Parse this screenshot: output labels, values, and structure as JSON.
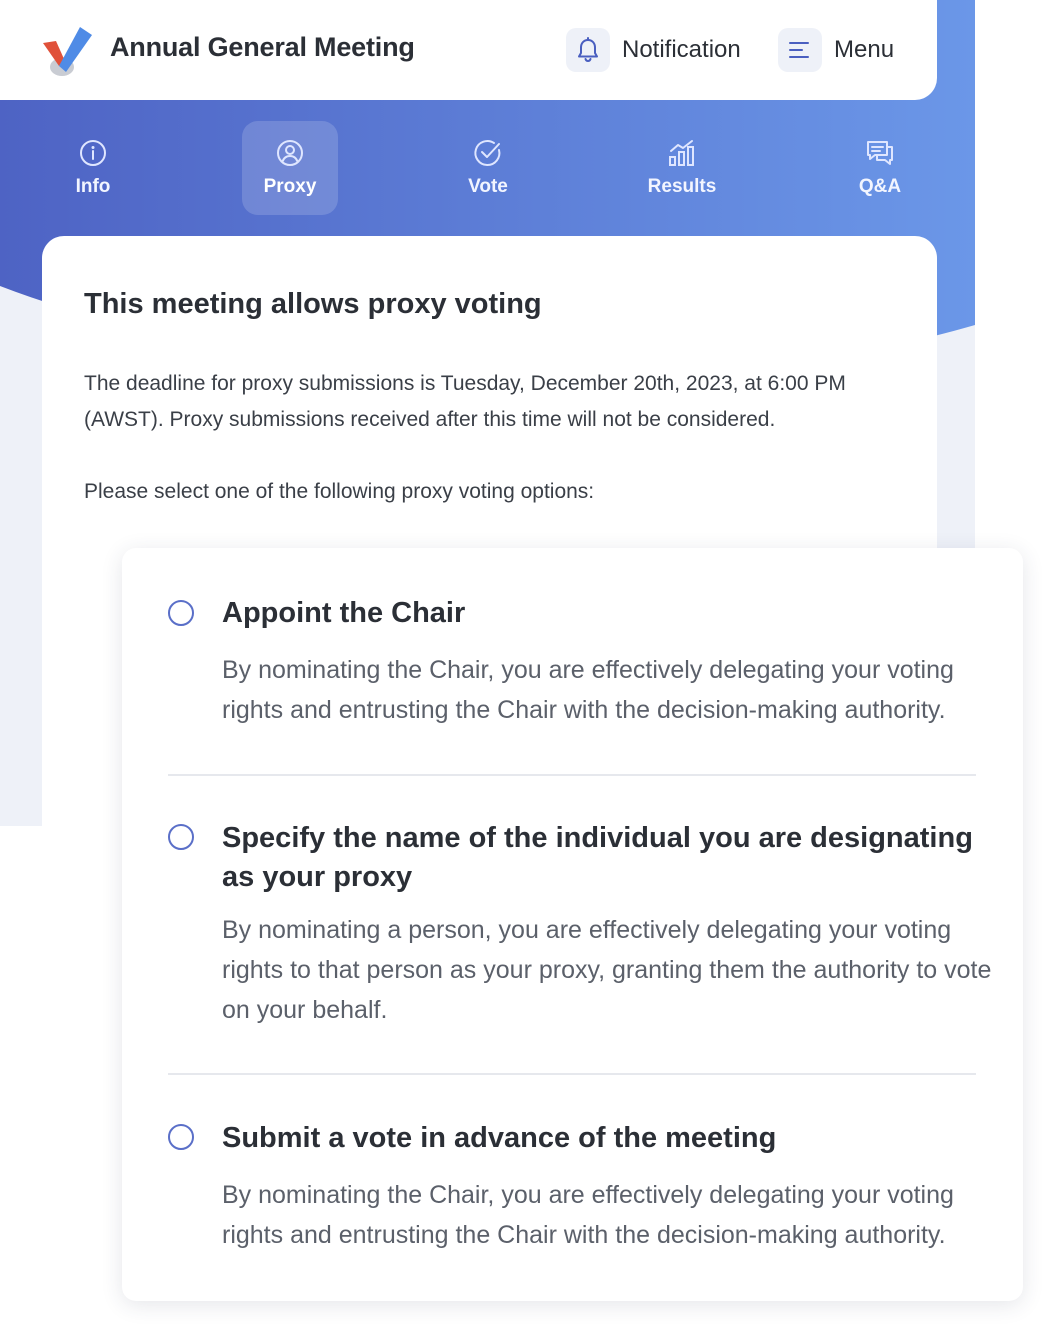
{
  "header": {
    "app_title": "Annual General Meeting",
    "notification_label": "Notification",
    "menu_label": "Menu",
    "icons": {
      "logo": "checkmark-logo",
      "notification": "bell-icon",
      "menu": "menu-lines-icon"
    }
  },
  "tabs": [
    {
      "label": "Info",
      "icon": "info-icon",
      "active": false
    },
    {
      "label": "Proxy",
      "icon": "user-circle-icon",
      "active": true
    },
    {
      "label": "Vote",
      "icon": "check-circle-icon",
      "active": false
    },
    {
      "label": "Results",
      "icon": "chart-icon",
      "active": false
    },
    {
      "label": "Q&A",
      "icon": "chat-icon",
      "active": false
    }
  ],
  "main": {
    "title": "This meeting allows proxy voting",
    "deadline_text": "The deadline for proxy submissions is Tuesday, December 20th, 2023, at 6:00 PM (AWST). Proxy submissions received after this time will not be considered.",
    "prompt": "Please select one of the following proxy voting options:"
  },
  "options": [
    {
      "title": "Appoint the Chair",
      "description": "By nominating the Chair, you are effectively delegating your voting rights and entrusting the Chair with the decision-making authority.",
      "selected": false
    },
    {
      "title": "Specify the name of the individual you are designating as your proxy",
      "description": "By nominating a person, you are effectively delegating your voting rights to that person as your proxy, granting them the authority to vote on your behalf.",
      "selected": false
    },
    {
      "title": "Submit a vote in advance of the meeting",
      "description": "By nominating the Chair, you are effectively delegating your voting rights and entrusting the Chair with the decision-making authority.",
      "selected": false
    }
  ],
  "colors": {
    "accent": "#5a6fc8",
    "banner_start": "#4e63c4",
    "banner_end": "#6b97e8",
    "logo_red": "#e0513a",
    "logo_blue": "#4f8be6",
    "background": "#eef1f8"
  }
}
